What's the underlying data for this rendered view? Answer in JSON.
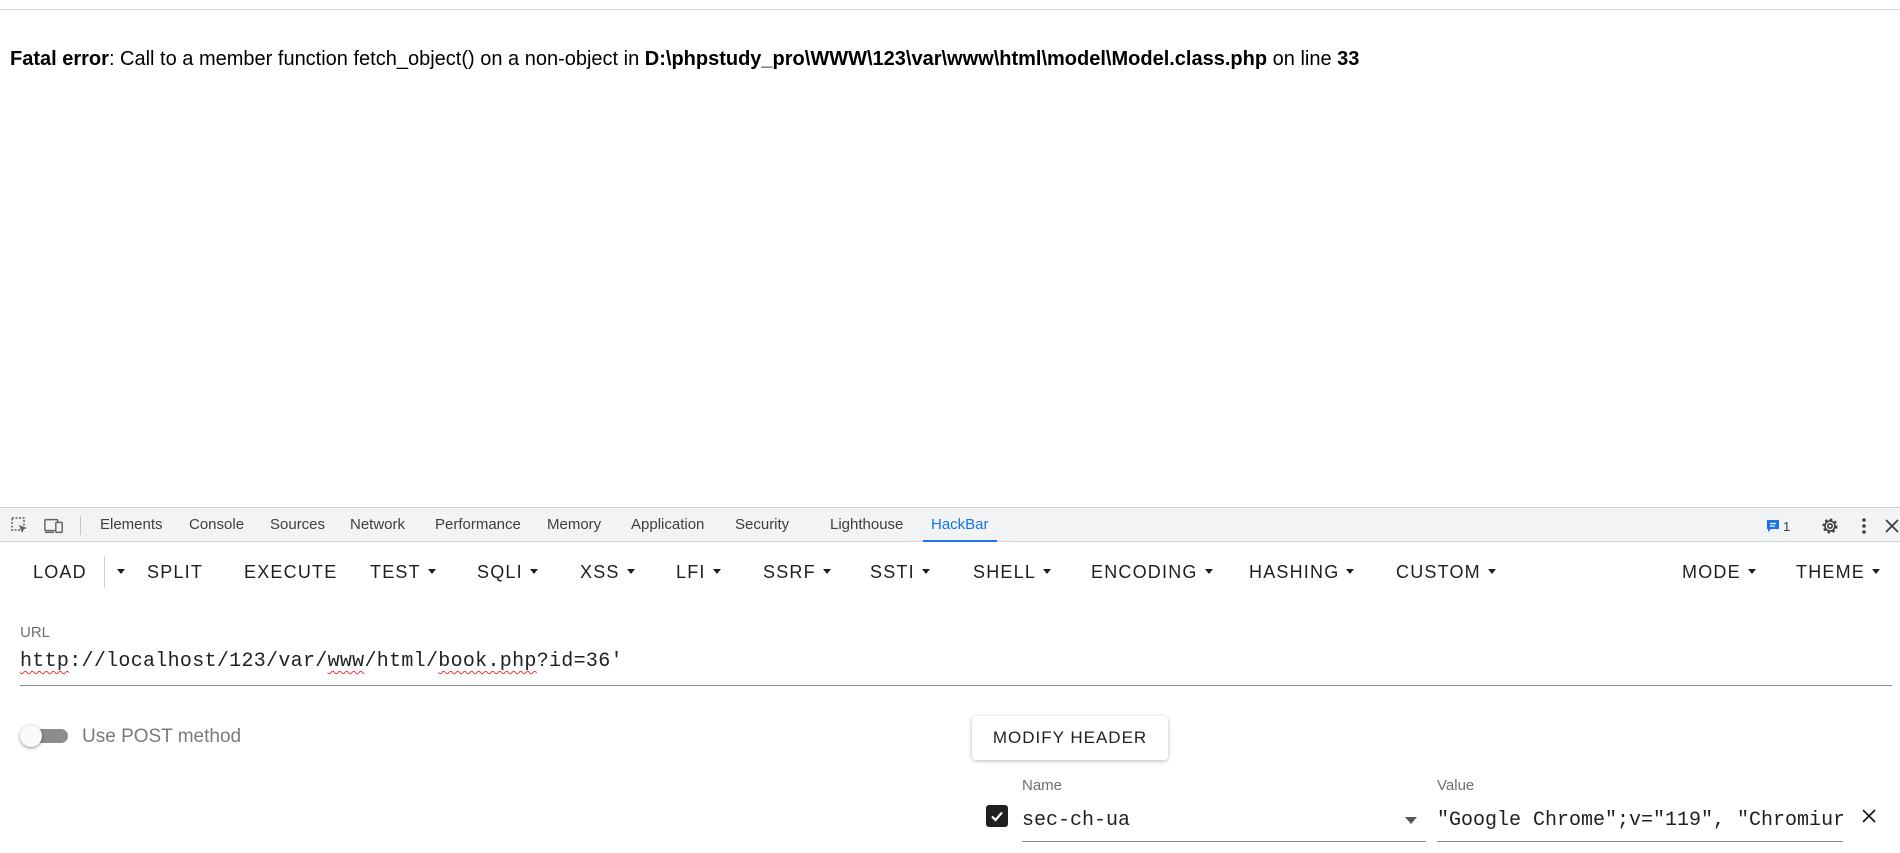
{
  "page": {
    "error": {
      "label": "Fatal error",
      "message": ": Call to a member function fetch_object() on a non-object in ",
      "path": "D:\\phpstudy_pro\\WWW\\123\\var\\www\\html\\model\\Model.class.php",
      "on_line_text": " on line ",
      "line_number": "33"
    }
  },
  "devtools": {
    "tabs": [
      {
        "label": "Elements"
      },
      {
        "label": "Console"
      },
      {
        "label": "Sources"
      },
      {
        "label": "Network"
      },
      {
        "label": "Performance"
      },
      {
        "label": "Memory"
      },
      {
        "label": "Application"
      },
      {
        "label": "Security"
      },
      {
        "label": "Lighthouse"
      },
      {
        "label": "HackBar",
        "active": true
      }
    ],
    "issues_count": "1",
    "accent_color": "#1a73e8",
    "icons": [
      "inspect-element-icon",
      "device-toolbar-icon",
      "issues-icon",
      "settings-gear-icon",
      "more-vertical-icon",
      "close-icon"
    ]
  },
  "hackbar": {
    "toolbar": {
      "load": "LOAD",
      "split": "SPLIT",
      "execute": "EXECUTE",
      "test": "TEST",
      "sqli": "SQLI",
      "xss": "XSS",
      "lfi": "LFI",
      "ssrf": "SSRF",
      "ssti": "SSTI",
      "shell": "SHELL",
      "encoding": "ENCODING",
      "hashing": "HASHING",
      "custom": "CUSTOM",
      "mode": "MODE",
      "theme": "THEME"
    },
    "url": {
      "label": "URL",
      "parts": {
        "p1": "http",
        "p2": "://localhost/123/var/",
        "p3": "www",
        "p4": "/html/",
        "p5": "book.php",
        "p6": "?id=36'"
      }
    },
    "post_toggle": {
      "label": "Use POST method",
      "enabled": false
    },
    "modify_header": {
      "label": "MODIFY HEADER"
    },
    "header_row": {
      "enabled": true,
      "name_label": "Name",
      "name_value": "sec-ch-ua",
      "value_label": "Value",
      "value_value": "\"Google Chrome\";v=\"119\", \"Chromiur"
    }
  }
}
